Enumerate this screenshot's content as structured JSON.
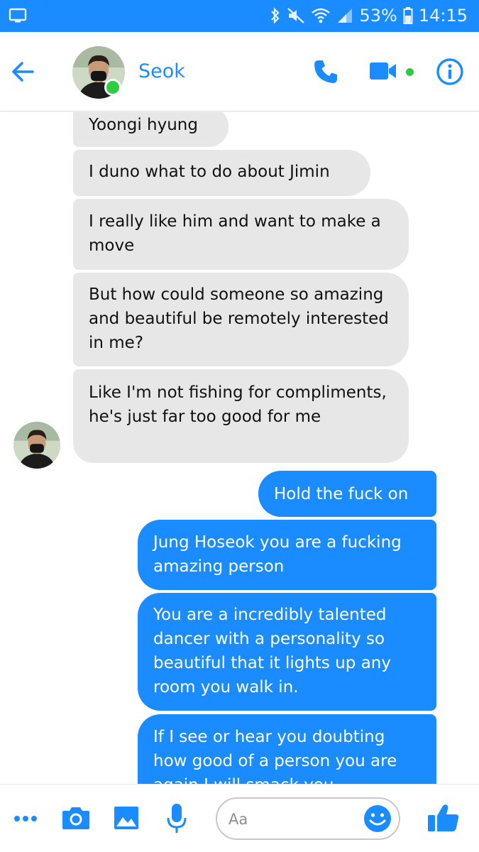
{
  "status_bar": {
    "battery": "53%",
    "time": "14:15"
  },
  "header": {
    "contact_name": "Seok",
    "accent_color": "#1a8cff",
    "online_color": "#2ecc40"
  },
  "messages": [
    {
      "direction": "incoming",
      "text": "Yoongi hyung"
    },
    {
      "direction": "incoming",
      "text": "I duno what to do about Jimin"
    },
    {
      "direction": "incoming",
      "text": "I really like him and want to make a move"
    },
    {
      "direction": "incoming",
      "text": "But how could someone so amazing and beautiful be remotely interested in me?"
    },
    {
      "direction": "incoming",
      "text": "Like I'm not fishing for compliments, he's just far too good for me"
    },
    {
      "direction": "outgoing",
      "text": "Hold the fuck on"
    },
    {
      "direction": "outgoing",
      "text": "Jung Hoseok you are a fucking amazing person"
    },
    {
      "direction": "outgoing",
      "text": "You are a incredibly talented dancer with a personality so beautiful that it lights up any room you walk in."
    },
    {
      "direction": "outgoing",
      "text": "If I see or hear you doubting how good of a person you are again I will smack you"
    }
  ],
  "composer": {
    "placeholder": "Aa",
    "icons": [
      "more-icon",
      "camera-icon",
      "gallery-icon",
      "microphone-icon",
      "emoji-icon",
      "thumbs-up-icon"
    ]
  }
}
